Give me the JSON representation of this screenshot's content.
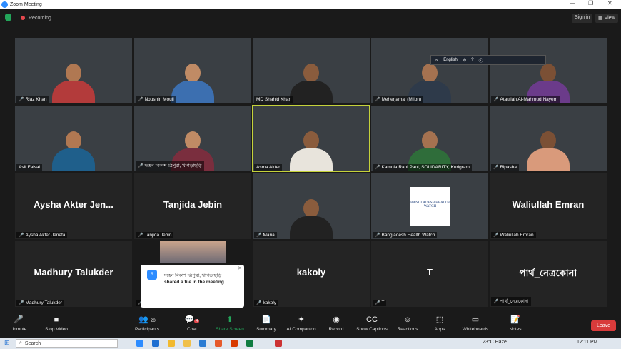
{
  "window": {
    "title": "Zoom Meeting"
  },
  "topbar": {
    "recording_label": "Recording",
    "signin_label": "Sign in",
    "view_label": "View"
  },
  "participants": [
    {
      "name": "Riaz Khan",
      "video": true,
      "muted": true
    },
    {
      "name": "Noushin Mouli",
      "video": true,
      "muted": true
    },
    {
      "name": "MD Shahid Khan",
      "video": true,
      "muted": false
    },
    {
      "name": "Meherjamal (Milon)",
      "video": true,
      "muted": true
    },
    {
      "name": "Ataullah Al-Mahmud Nayem",
      "video": true,
      "muted": true
    },
    {
      "name": "Asif Faisal",
      "video": true,
      "muted": false
    },
    {
      "name": "দহেন বিকাশ ত্রিপুরা, খাগড়াছড়ি",
      "video": true,
      "muted": true
    },
    {
      "name": "Asma Akter",
      "video": true,
      "muted": false,
      "active": true
    },
    {
      "name": "Kamola Rani Paul, SOLIDARITY, Kurigram",
      "video": true,
      "muted": true
    },
    {
      "name": "Bipasha",
      "video": true,
      "muted": true
    },
    {
      "name": "Aysha Akter Jenefa",
      "display": "Aysha Akter Jen...",
      "video": false,
      "muted": true
    },
    {
      "name": "Tanjida Jebin",
      "display": "Tanjida Jebin",
      "video": false,
      "muted": true
    },
    {
      "name": "Maria",
      "video": true,
      "muted": true
    },
    {
      "name": "Bangladesh Health Watch",
      "video": true,
      "muted": true,
      "logo_text": "BANGLADESH HEALTH WATCH"
    },
    {
      "name": "Waliullah Emran",
      "display": "Waliullah Emran",
      "video": false,
      "muted": true
    },
    {
      "name": "Madhury Talukder",
      "display": "Madhury Talukder",
      "video": false,
      "muted": true
    },
    {
      "name": "",
      "video": true,
      "muted": true
    },
    {
      "name": "kakoly",
      "display": "kakoly",
      "video": false,
      "muted": true
    },
    {
      "name": "T",
      "display": "T",
      "video": false,
      "muted": true
    },
    {
      "name": "পার্থ_নেত্রকোনা",
      "display": "পার্থ_নেত্রকোনা",
      "video": false,
      "muted": true
    }
  ],
  "langbar": {
    "label": "English"
  },
  "toast": {
    "sender": "দহেন বিকাশ ত্রিপুরা, খাগড়াছড়ি",
    "message": "shared a file in the meeting.",
    "avatar_letter": "দ"
  },
  "toolbar": {
    "unmute": "Unmute",
    "stop_video": "Stop Video",
    "participants": "Participants",
    "participants_count": "20",
    "chat": "Chat",
    "chat_badge": "4",
    "share_screen": "Share Screen",
    "summary": "Summary",
    "ai_companion": "AI Companion",
    "record": "Record",
    "show_captions": "Show Captions",
    "reactions": "Reactions",
    "apps": "Apps",
    "whiteboards": "Whiteboards",
    "notes": "Notes",
    "leave": "Leave"
  },
  "taskbar": {
    "search_placeholder": "Search",
    "weather": "23°C  Haze",
    "time": "12:11 PM"
  },
  "colors": {
    "accent": "#2d8cff",
    "active_border": "#c5d23a",
    "leave": "#d83b3b",
    "share": "#23a55a"
  }
}
